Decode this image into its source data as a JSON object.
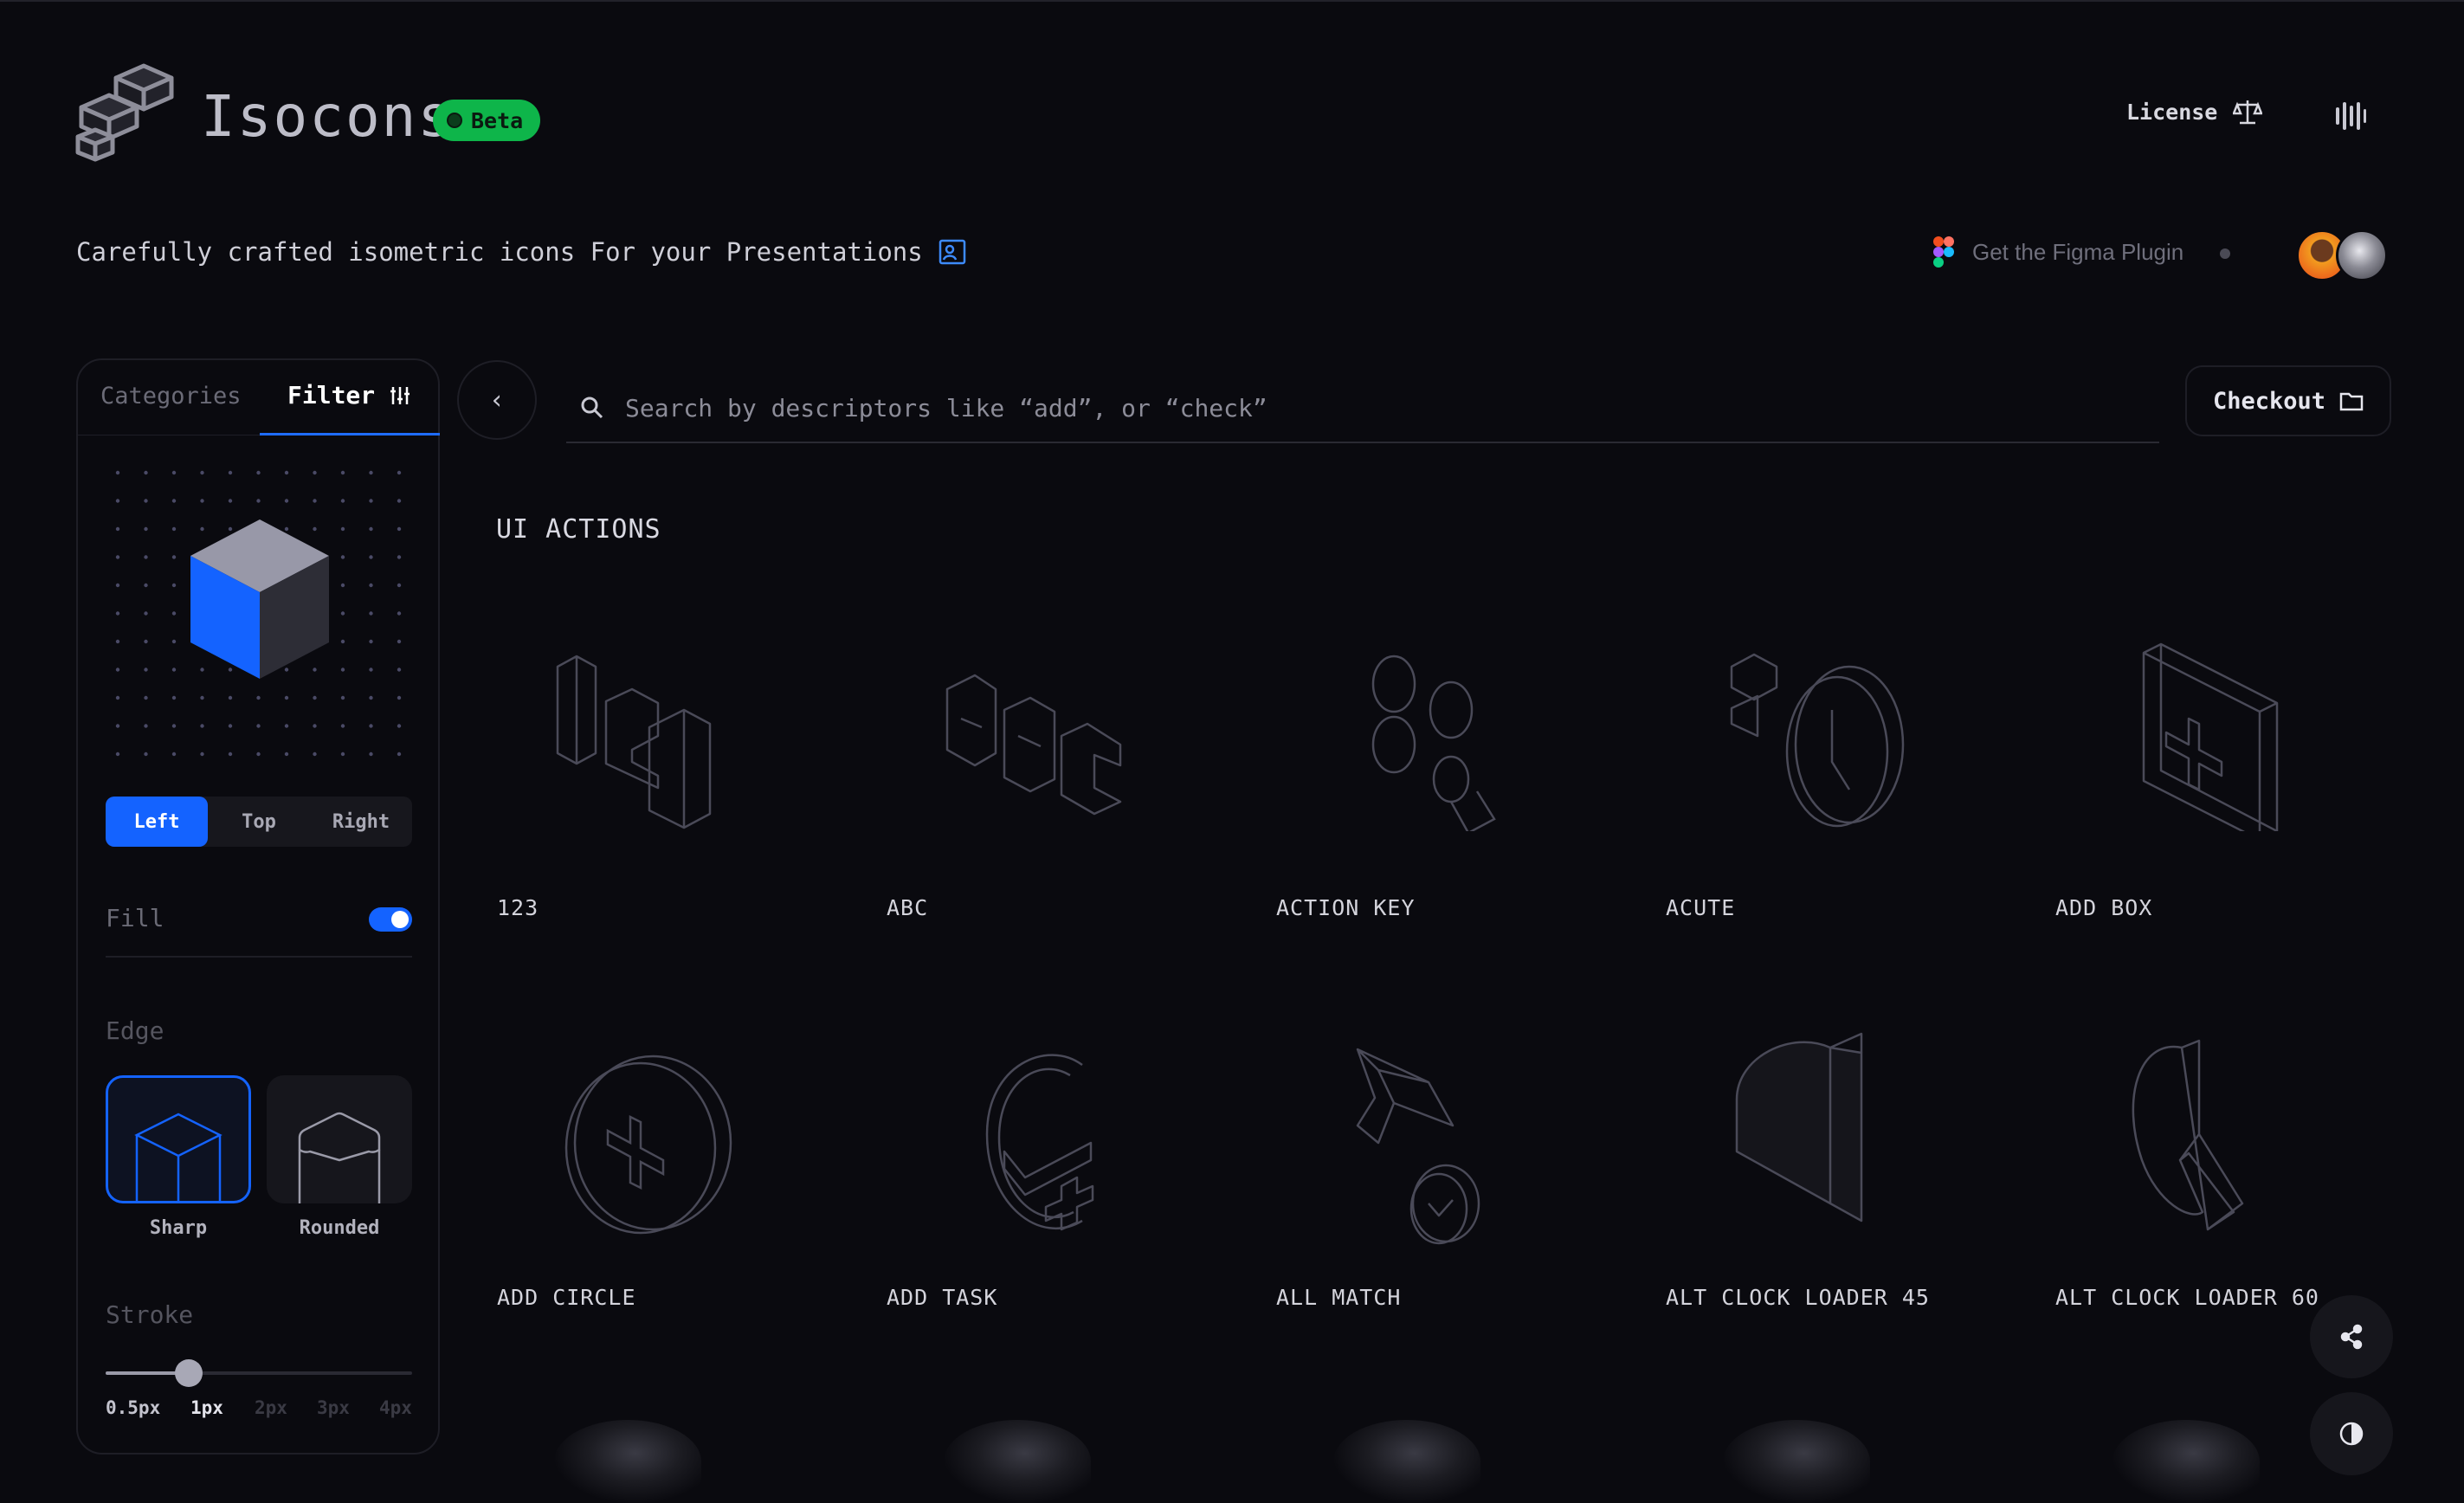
{
  "app": {
    "name": "Isocons",
    "badge": "Beta"
  },
  "header": {
    "license_label": "License",
    "bars_icon": "equalizer-icon"
  },
  "tagline": "Carefully crafted isometric icons For your Presentations",
  "figma_plugin_label": "Get the Figma Plugin",
  "sidebar": {
    "tabs": [
      {
        "label": "Categories",
        "active": false
      },
      {
        "label": "Filter",
        "active": true
      }
    ],
    "view_options": [
      {
        "label": "Left",
        "active": true
      },
      {
        "label": "Top",
        "active": false
      },
      {
        "label": "Right",
        "active": false
      }
    ],
    "fill": {
      "label": "Fill",
      "enabled": true
    },
    "edge": {
      "label": "Edge",
      "options": [
        {
          "label": "Sharp",
          "selected": true
        },
        {
          "label": "Rounded",
          "selected": false
        }
      ]
    },
    "stroke": {
      "label": "Stroke",
      "options": [
        "0.5px",
        "1px",
        "2px",
        "3px",
        "4px"
      ],
      "selected": "1px",
      "value_fraction": 0.25
    }
  },
  "search": {
    "placeholder": "Search by descriptors like “add”, or “check”"
  },
  "checkout_label": "Checkout",
  "section_title": "UI ACTIONS",
  "icons": [
    {
      "label": "123"
    },
    {
      "label": "ABC"
    },
    {
      "label": "ACTION KEY"
    },
    {
      "label": "ACUTE"
    },
    {
      "label": "ADD BOX"
    },
    {
      "label": "ADD CIRCLE"
    },
    {
      "label": "ADD TASK"
    },
    {
      "label": "ALL MATCH"
    },
    {
      "label": "ALT CLOCK LOADER 45"
    },
    {
      "label": "ALT CLOCK LOADER 60"
    }
  ],
  "colors": {
    "accent": "#1463ff",
    "beta": "#0eb54a",
    "background": "#0a0a0f"
  }
}
